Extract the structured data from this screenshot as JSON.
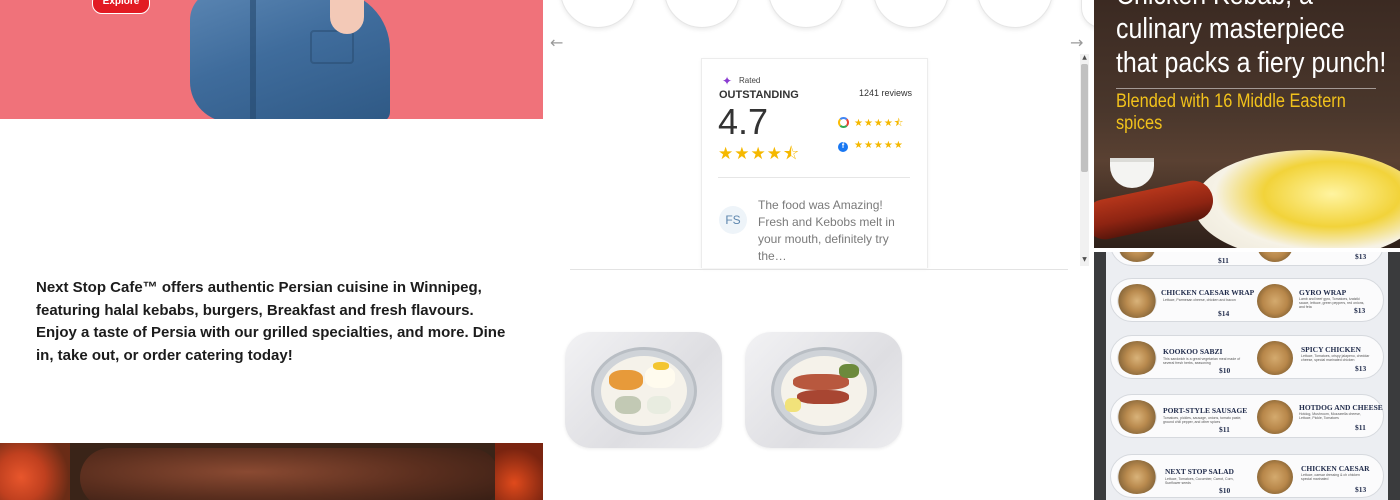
{
  "hero": {
    "explore_label": "Explore"
  },
  "about": {
    "description": "Next Stop Cafe™ offers authentic Persian cuisine in Winnipeg, featuring halal kebabs, burgers, Breakfast and fresh flavours. Enjoy a taste of Persia with our grilled specialties, and more. Dine in, take out, or order catering today!"
  },
  "carousel": {
    "prev_arrow": "←",
    "next_arrow": "→"
  },
  "reviews": {
    "rated_label": "Rated",
    "rating_word": "OUTSTANDING",
    "review_count": "1241 reviews",
    "score": "4.7",
    "stars_overall": "★★★★⯪",
    "google_stars": "★★★★⯪",
    "facebook_stars": "★★★★★",
    "facebook_icon_glyph": "f",
    "reviewer_initials": "FS",
    "review_text": "The food was Amazing! Fresh and Kebobs melt in your mouth, definitely try the…",
    "scroll_up": "▲",
    "scroll_down": "▼"
  },
  "promo": {
    "headline": "Chicken Kebab, a culinary masterpiece that packs a fiery punch!",
    "subheadline": "Blended with 16 Middle Eastern spices"
  },
  "menu_board": {
    "items": [
      {
        "left_name": "",
        "left_price": "$11",
        "right_name": "",
        "right_price": "$13",
        "left_desc": "",
        "right_desc": ""
      },
      {
        "left_name": "CHICKEN CAESAR WRAP",
        "left_price": "$14",
        "left_desc": "Lettuce, Parmesan cheese, chicken and bacon",
        "right_name": "GYRO WRAP",
        "right_price": "$13",
        "right_desc": "Lamb and beef gyro, Tomatoes, tzatziki sauce, lettuce, green peppers, red onions, and feta"
      },
      {
        "left_name": "KOOKOO SABZI",
        "left_price": "$10",
        "left_desc": "This sandwich is a great vegetarian meal made of several fresh herbs, seasoning",
        "right_name": "SPICY CHICKEN",
        "right_price": "$13",
        "right_desc": "Lettuce, Tomatoes, crispy jalapeno, cheddar cheese, special marinated chicken"
      },
      {
        "left_name": "PORT-STYLE SAUSAGE",
        "left_price": "$11",
        "left_desc": "Tomatoes, pickles, sausage, onions, tomato paste, ground chili pepper, and other spices",
        "right_name": "HOTDOG AND CHEESE",
        "right_price": "$11",
        "right_desc": "Hotdog, Mushroom, Mozzarella cheese, Lettuce, Pickle, Tomatoes"
      },
      {
        "left_name": "NEXT STOP SALAD",
        "left_price": "$10",
        "left_desc": "Lettuce, Tomatoes, Cucumber, Carrot, Corn, Sunflower seeds",
        "right_name": "CHICKEN CAESAR",
        "right_price": "$13",
        "right_desc": "Lettuce, caesar dressing & ch chicken special marinated"
      }
    ]
  },
  "colors": {
    "hero_top_bg": "#f0727a",
    "explore_button": "#e21b23",
    "promo_subheadline": "#f2c21b",
    "star": "#f5b800",
    "rated_icon": "#8a3bd1"
  },
  "icons": {
    "rated": "ribbon-icon",
    "google": "google-icon",
    "facebook": "facebook-icon"
  }
}
